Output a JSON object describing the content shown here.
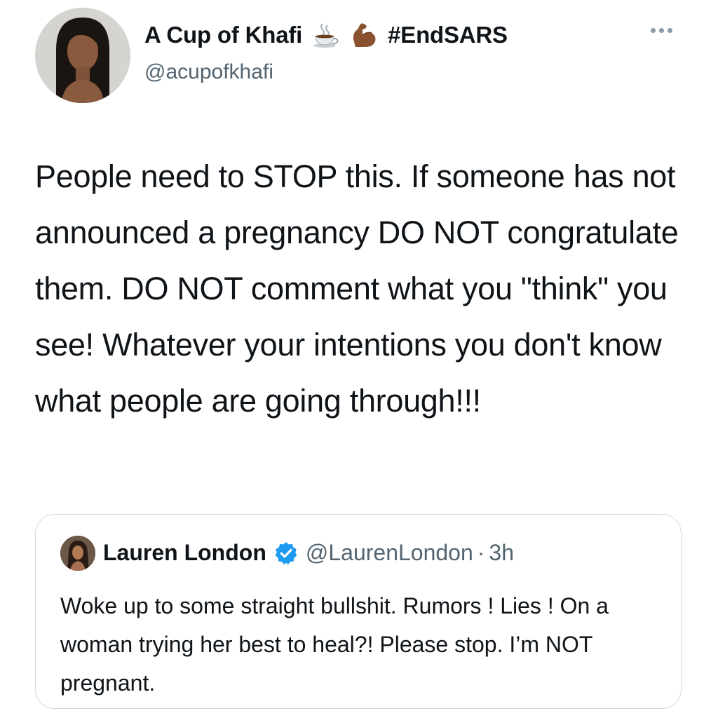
{
  "tweet": {
    "author_name": "A Cup of Khafi",
    "author_emojis": [
      "hot-beverage-icon",
      "flexed-biceps-icon"
    ],
    "author_hashtag": "#EndSARS",
    "handle": "@acupofkhafi",
    "text": "People need to STOP this. If someone has not announced a pregnancy DO NOT congratulate them. DO NOT comment what you \"think\" you see! Whatever your intentions you don't know what people are going through!!!"
  },
  "quoted_tweet": {
    "author_name": "Lauren London",
    "verified": true,
    "handle": "@LaurenLondon",
    "separator": "·",
    "time": "3h",
    "text": "Woke up to some straight bullshit. Rumors ! Lies ! On a woman trying her best to heal?! Please stop. I’m NOT pregnant."
  },
  "colors": {
    "text": "#0f1419",
    "secondary": "#536471",
    "verified": "#1d9bf0",
    "border": "#cfd9de"
  }
}
